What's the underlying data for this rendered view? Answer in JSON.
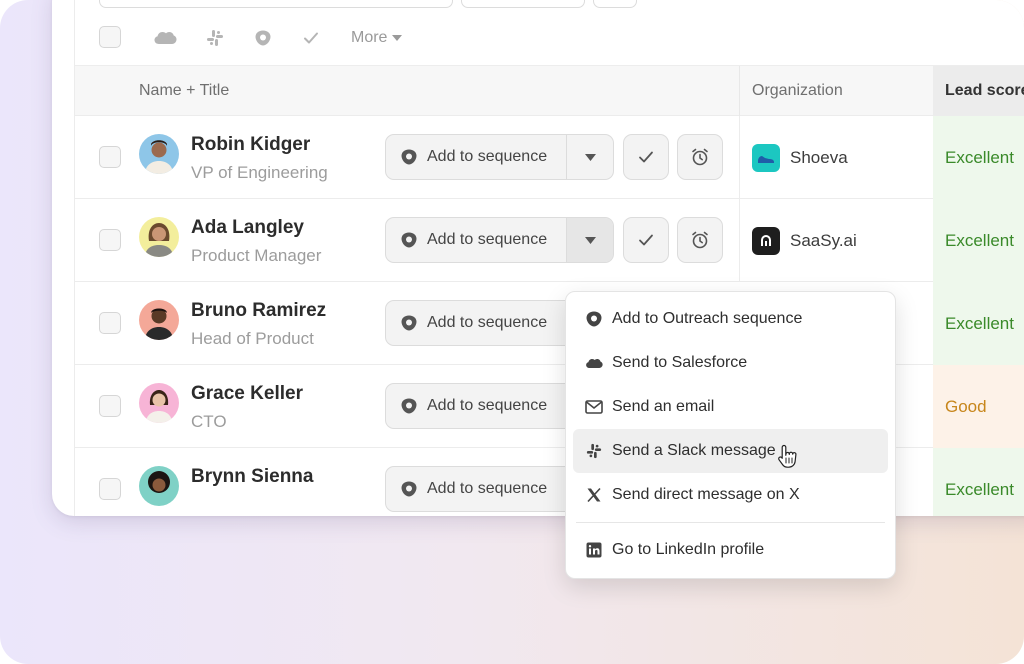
{
  "toolbar": {
    "more_label": "More",
    "icons": [
      "salesforce-icon",
      "slack-icon",
      "outreach-icon",
      "check-icon"
    ]
  },
  "table": {
    "headers": {
      "name_title": "Name + Title",
      "organization": "Organization",
      "lead_score": "Lead score"
    },
    "rows": [
      {
        "name": "Robin Kidger",
        "title": "VP of Engineering",
        "sequence_label": "Add to sequence",
        "org": "Shoeva",
        "lead": "Excellent",
        "lead_level": "excellent"
      },
      {
        "name": "Ada Langley",
        "title": "Product Manager",
        "sequence_label": "Add to sequence",
        "org": "SaaSy.ai",
        "lead": "Excellent",
        "lead_level": "excellent"
      },
      {
        "name": "Bruno Ramirez",
        "title": "Head of Product",
        "sequence_label": "Add to sequence",
        "org": "",
        "lead": "Excellent",
        "lead_level": "excellent"
      },
      {
        "name": "Grace Keller",
        "title": "CTO",
        "sequence_label": "Add to sequence",
        "org": "",
        "lead": "Good",
        "lead_level": "good"
      },
      {
        "name": "Brynn Sienna",
        "title": "",
        "sequence_label": "Add to sequence",
        "org": "",
        "lead": "Excellent",
        "lead_level": "excellent"
      }
    ]
  },
  "dropdown": {
    "items": [
      {
        "label": "Add to Outreach sequence",
        "icon": "outreach-icon"
      },
      {
        "label": "Send to Salesforce",
        "icon": "salesforce-icon"
      },
      {
        "label": "Send an email",
        "icon": "mail-icon"
      },
      {
        "label": "Send a Slack message",
        "icon": "slack-icon",
        "hovered": true
      },
      {
        "label": "Send direct message on X",
        "icon": "x-icon"
      },
      {
        "label": "Go to LinkedIn profile",
        "icon": "linkedin-icon"
      }
    ]
  },
  "colors": {
    "excellent": "#3a8a2a",
    "good": "#c7861b",
    "shoeva_logo": "#1cc7c1",
    "saasy_logo": "#1e1e1e"
  }
}
